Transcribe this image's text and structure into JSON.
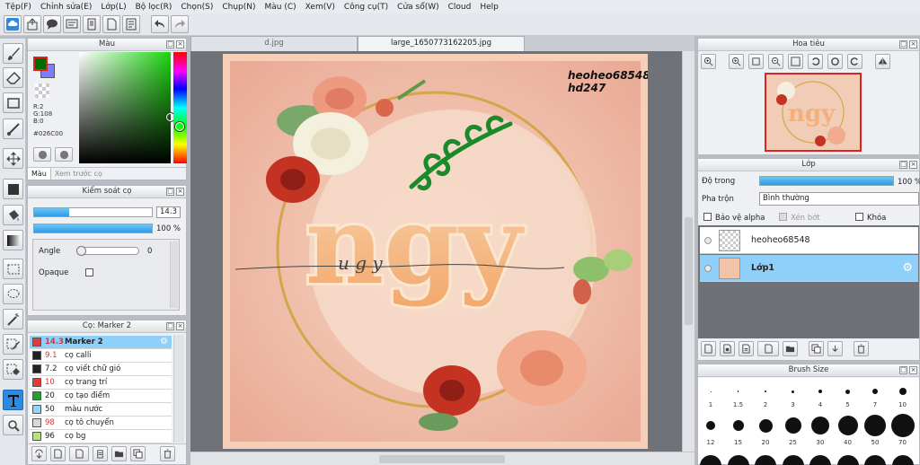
{
  "menu": [
    "Tệp(F)",
    "Chỉnh sửa(E)",
    "Lớp(L)",
    "Bộ lọc(R)",
    "Chọn(S)",
    "Chụp(N)",
    "Màu (C)",
    "Xem(V)",
    "Công cụ(T)",
    "Cửa sổ(W)",
    "Cloud",
    "Help"
  ],
  "toolbar_icons": [
    "cloud-icon",
    "share-icon",
    "chat-icon",
    "message-icon",
    "document-icon",
    "page-icon",
    "book-icon",
    "undo-icon",
    "redo-icon"
  ],
  "left_tools": [
    "brush-icon",
    "eraser-icon",
    "rectangle-select-icon",
    "line-icon",
    "move-icon",
    "fill-rect-icon",
    "bucket-icon",
    "gradient-icon",
    "marquee-icon",
    "lasso-icon",
    "magic-wand-icon",
    "select-pen-icon",
    "select-eraser-icon",
    "text-icon",
    "hand-icon"
  ],
  "color_panel": {
    "title": "Màu",
    "rgb_r": "R:2",
    "rgb_g": "G:108",
    "rgb_b": "B:0",
    "hex": "#026C00",
    "fg_color": "#026c00",
    "bg_color": "#7b7cff",
    "tab_color": "Màu",
    "tab_preview": "Xem trước cọ"
  },
  "brush_control": {
    "title": "Kiểm soát cọ",
    "size_value": "14.3",
    "size_fraction": 0.3,
    "opacity_value": "100 %",
    "opacity_fraction": 1.0,
    "angle_label": "Angle",
    "angle_value": "0",
    "opaque_label": "Opaque"
  },
  "brush_list": {
    "title": "Cọ: Marker 2",
    "items": [
      {
        "num": "14.3",
        "name": "Marker 2",
        "color": "#e23b3b"
      },
      {
        "num": "9.1",
        "name": "cọ calli",
        "color": "#222222"
      },
      {
        "num": "7.2",
        "name": "cọ viết chữ gió",
        "color": "#222222"
      },
      {
        "num": "10",
        "name": "cọ trang trí",
        "color": "#e23b3b"
      },
      {
        "num": "20",
        "name": "cọ tạo điểm",
        "color": "#1fa32a"
      },
      {
        "num": "50",
        "name": "màu nước",
        "color": "#8ed6f5"
      },
      {
        "num": "98",
        "name": "cọ tô chuyển",
        "color": "#d8d8d8"
      },
      {
        "num": "96",
        "name": "cọ bg",
        "color": "#b9e27a"
      }
    ]
  },
  "tabs": [
    {
      "label": "d.jpg",
      "active": false
    },
    {
      "label": "large_1650773162205.jpg",
      "active": true
    }
  ],
  "artwork": {
    "signature_line1": "heoheo68548",
    "signature_line2": "hd247",
    "lettering": "ngy",
    "small_lettering": "u  g  y"
  },
  "navigator": {
    "title": "Hoa tiêu"
  },
  "layer_panel": {
    "title": "Lớp",
    "opacity_label": "Độ trong",
    "opacity_value": "100 %",
    "opacity_fraction": 1.0,
    "blend_label": "Pha trộn",
    "blend_value": "Bình thường",
    "protect_alpha": "Bảo vệ alpha",
    "clipping": "Xén bớt",
    "lock": "Khóa",
    "layers": [
      {
        "name": "heoheo68548",
        "selected": false
      },
      {
        "name": "Lớp1",
        "selected": true
      }
    ]
  },
  "brush_size": {
    "title": "Brush Size",
    "row1": [
      "1",
      "1.5",
      "2",
      "3",
      "4",
      "5",
      "7",
      "10"
    ],
    "row2": [
      "12",
      "15",
      "20",
      "25",
      "30",
      "40",
      "50",
      "70"
    ]
  }
}
